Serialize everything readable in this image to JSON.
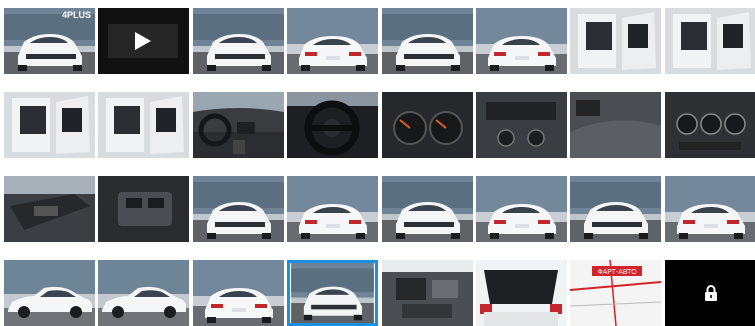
{
  "gallery": {
    "selected_index": 27,
    "locked_index": 31,
    "video_index": 1,
    "thumbnails": [
      {
        "kind": "exterior-front",
        "showroom_sign": "4PLUS"
      },
      {
        "kind": "video"
      },
      {
        "kind": "exterior-front"
      },
      {
        "kind": "exterior-rear"
      },
      {
        "kind": "exterior-front"
      },
      {
        "kind": "exterior-rear"
      },
      {
        "kind": "open-door"
      },
      {
        "kind": "open-door"
      },
      {
        "kind": "open-door"
      },
      {
        "kind": "open-door"
      },
      {
        "kind": "dashboard"
      },
      {
        "kind": "steering-wheel"
      },
      {
        "kind": "instrument-cluster"
      },
      {
        "kind": "console"
      },
      {
        "kind": "dash-vents"
      },
      {
        "kind": "climate-controls"
      },
      {
        "kind": "door-panel"
      },
      {
        "kind": "window-switches"
      },
      {
        "kind": "exterior-front"
      },
      {
        "kind": "exterior-rear"
      },
      {
        "kind": "exterior-front"
      },
      {
        "kind": "exterior-rear"
      },
      {
        "kind": "exterior-front"
      },
      {
        "kind": "exterior-rear"
      },
      {
        "kind": "exterior-side"
      },
      {
        "kind": "exterior-side"
      },
      {
        "kind": "exterior-rear"
      },
      {
        "kind": "exterior-front"
      },
      {
        "kind": "engine-bay"
      },
      {
        "kind": "trunk"
      },
      {
        "kind": "map",
        "label": "ФАРТ-АВТО"
      },
      {
        "kind": "locked",
        "icon": "lock-icon"
      }
    ]
  }
}
